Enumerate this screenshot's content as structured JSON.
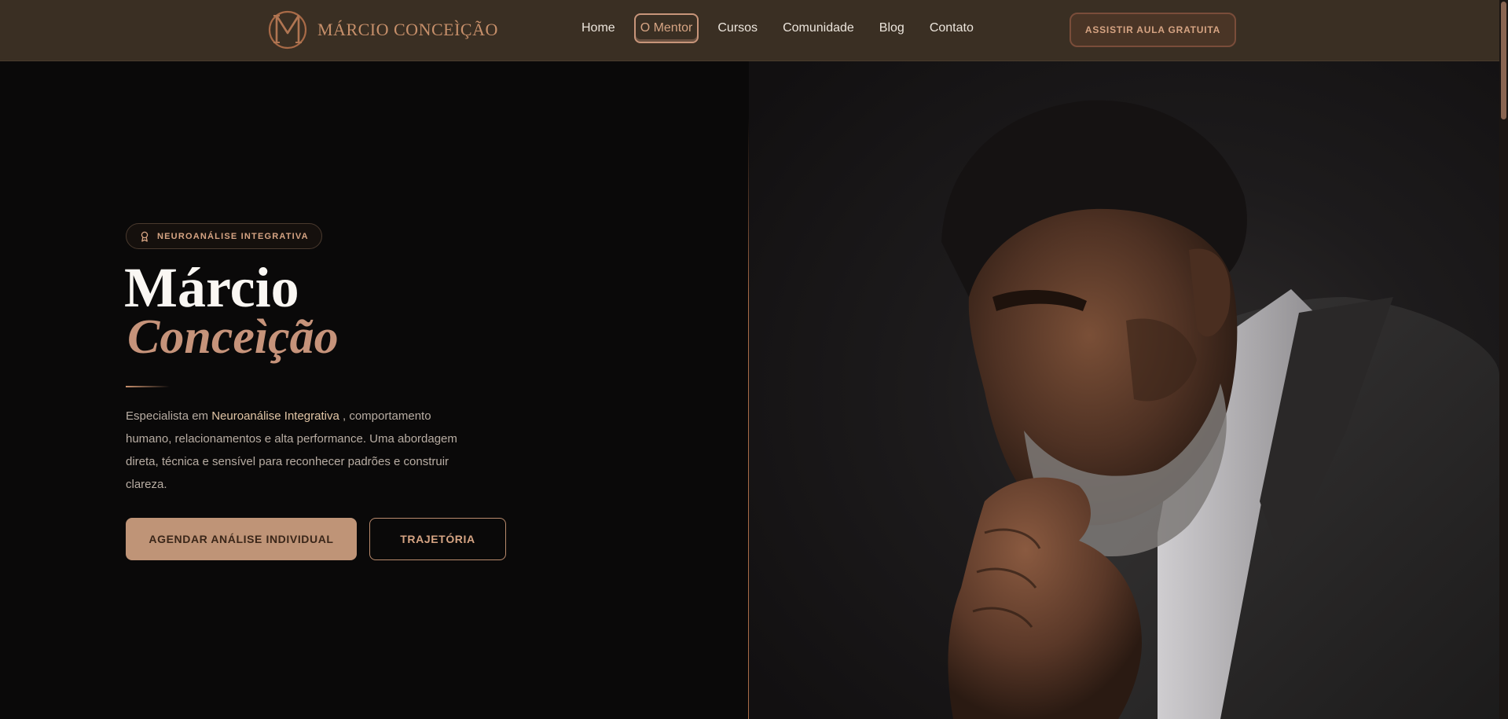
{
  "header": {
    "brand_name": "MÁRCIO CONCEÌÇÃO",
    "brand_monogram": "MC",
    "nav": [
      {
        "label": "Home",
        "active": false
      },
      {
        "label": "O Mentor",
        "active": true
      },
      {
        "label": "Cursos",
        "active": false
      },
      {
        "label": "Comunidade",
        "active": false
      },
      {
        "label": "Blog",
        "active": false
      },
      {
        "label": "Contato",
        "active": false
      }
    ],
    "cta_label": "ASSISTIR AULA GRATUITA"
  },
  "hero": {
    "badge_icon": "award-icon",
    "badge_label": "NEUROANÁLISE INTEGRATIVA",
    "first_name": "Márcio",
    "last_name": "Conceìção",
    "lead_before": "Especialista em ",
    "lead_highlight": "Neuroanálise Integrativa",
    "lead_after": " , comportamento humano, relacionamentos e alta performance. Uma abordagem direta, técnica e sensível para reconhecer padrões e construir clareza.",
    "primary_button": "AGENDAR ANÁLISE INDIVIDUAL",
    "secondary_button": "TRAJETÓRIA",
    "portrait_subject": "man-portrait-image"
  },
  "colors": {
    "header_bg": "#3a2f23",
    "page_bg": "#0a0909",
    "accent": "#c6937a",
    "accent_bright": "#d6a483",
    "button_fill": "#bf9477"
  }
}
